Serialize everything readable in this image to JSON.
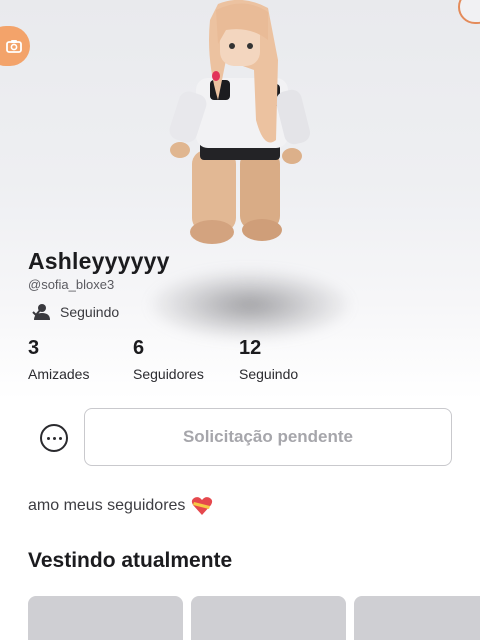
{
  "profile": {
    "display_name": "Ashleyyyyyy",
    "username": "@sofia_bloxe3",
    "relationship_label": "Seguindo",
    "bio": "amo meus seguidores",
    "bio_emoji_icon": "heart-with-ribbon-icon"
  },
  "stats": [
    {
      "value": "3",
      "label": "Amizades"
    },
    {
      "value": "6",
      "label": "Seguidores"
    },
    {
      "value": "12",
      "label": "Seguindo"
    }
  ],
  "actions": {
    "more_icon": "more-options-icon",
    "request_button_label": "Solicitação pendente"
  },
  "wearing": {
    "title": "Vestindo atualmente",
    "item_count_visible": 3
  },
  "colors": {
    "accent_orange": "#f3a36a",
    "muted_text": "#a6a6ab",
    "tile_gray": "#cfcfd3"
  }
}
